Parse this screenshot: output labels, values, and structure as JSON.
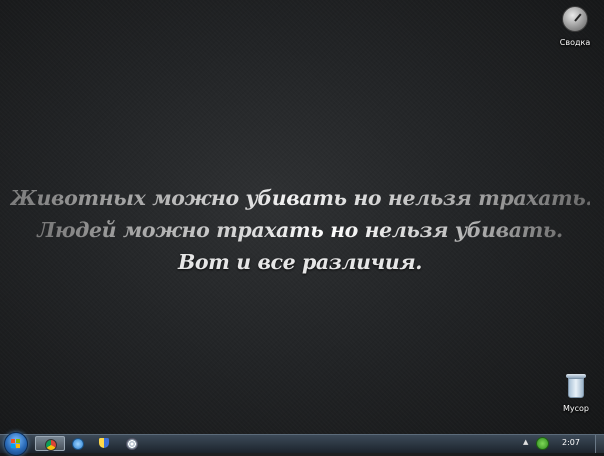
{
  "wallpaper": {
    "quote_lines": [
      "Животных можно убивать но нельзя трахать.",
      "Людей можно трахать но нельзя убивать.",
      "Вот и все различия."
    ]
  },
  "desktop_icons": {
    "summary": {
      "label": "Сводка",
      "icon": "gauge-icon"
    },
    "trash": {
      "label": "Мусор",
      "icon": "recycle-bin-icon"
    }
  },
  "taskbar": {
    "pinned": [
      "chrome-icon",
      "qip-icon",
      "shield-icon",
      "fingerprint-icon"
    ],
    "clock": "2:07"
  },
  "colors": {
    "taskbar_top": "#3d4a58",
    "taskbar_bottom": "#1b232c",
    "desktop_bg": "#222426"
  }
}
